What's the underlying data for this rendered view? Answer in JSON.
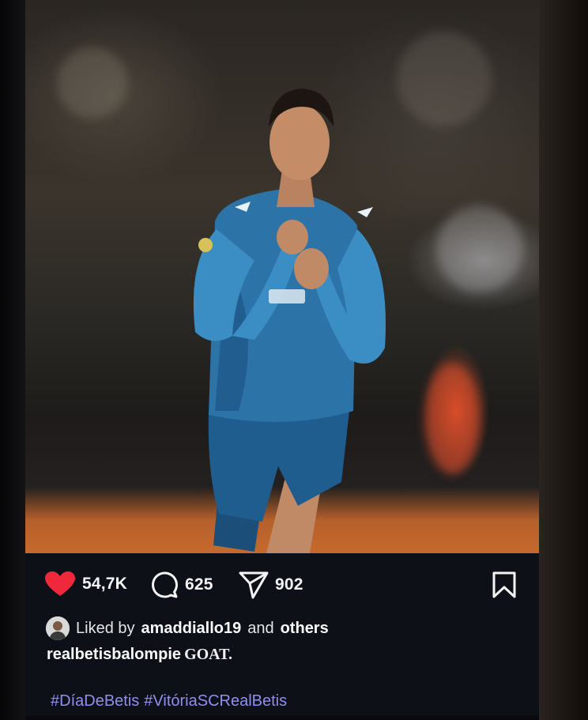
{
  "post": {
    "likes_count": "54,7K",
    "comments_count": "625",
    "shares_count": "902",
    "liked_by_prefix": "Liked by",
    "liked_by_user": "amaddiallo19",
    "liked_by_and": "and",
    "liked_by_others": "others",
    "caption_user": "realbetisbalompie",
    "caption_text": "GOAT.",
    "hashtags": [
      "#DíaDeBetis",
      "#VitóriaSCRealBetis"
    ]
  },
  "icons": {
    "like": "heart-icon",
    "comment": "comment-icon",
    "share": "paper-plane-icon",
    "save": "bookmark-icon"
  },
  "colors": {
    "heart": "#f0283c",
    "hashtag": "#8f8ff0",
    "card_background": "#0d1017"
  }
}
